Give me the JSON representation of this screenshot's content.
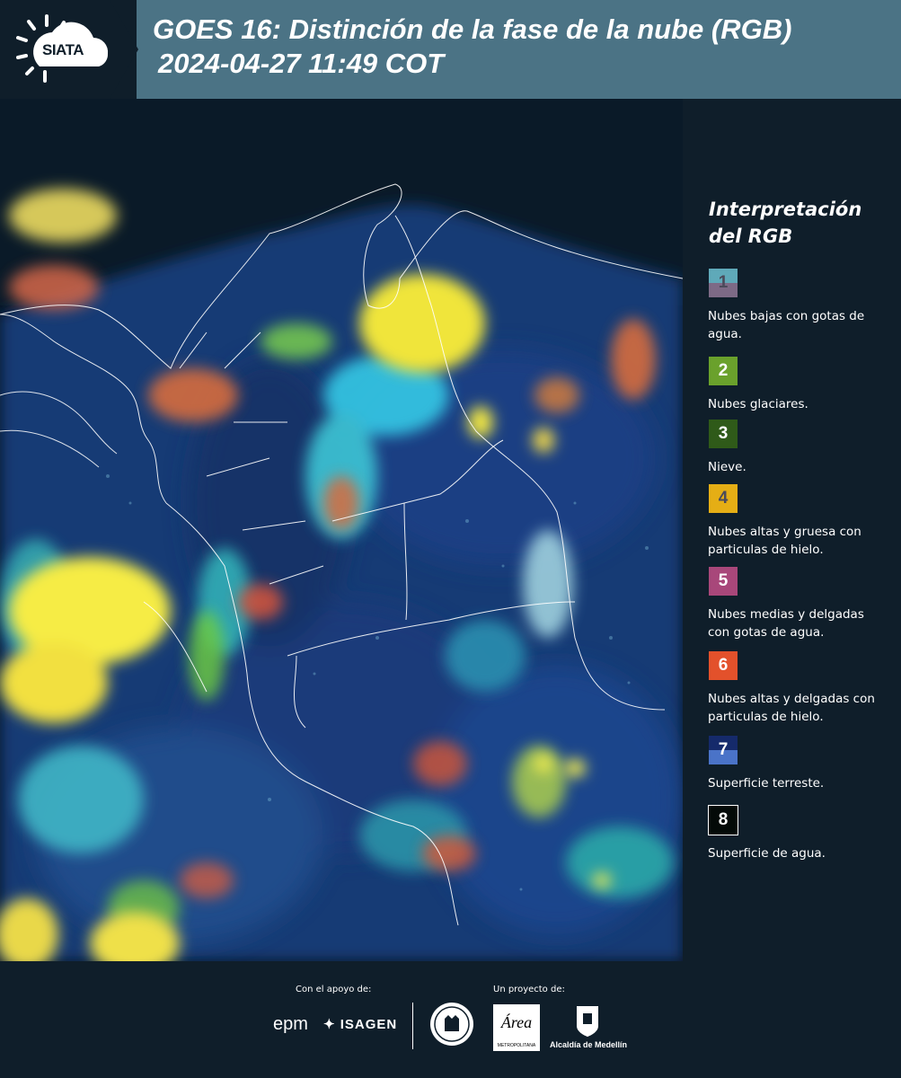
{
  "header": {
    "logo_text": "SIATA",
    "title_line1": "GOES 16: Distinción de la fase de la nube (RGB)",
    "title_line2": "2024-04-27 11:49 COT"
  },
  "legend": {
    "title_line1": "Interpretación",
    "title_line2": "del RGB",
    "items": [
      {
        "number": "1",
        "label": "Nubes bajas con gotas de agua.",
        "top_color": "#5fa9b9",
        "bottom_color": "#7d6a86",
        "text_color": "#4a4a5a"
      },
      {
        "number": "2",
        "label": "Nubes glaciares.",
        "top_color": "#6aa12c",
        "bottom_color": "#6aa12c",
        "text_color": "#ffffff"
      },
      {
        "number": "3",
        "label": "Nieve.",
        "top_color": "#2f5a19",
        "bottom_color": "#2f5a19",
        "text_color": "#ffffff"
      },
      {
        "number": "4",
        "label": "Nubes altas y gruesa con particulas de hielo.",
        "top_color": "#e5ae15",
        "bottom_color": "#e5ae15",
        "text_color": "#4a4a5a"
      },
      {
        "number": "5",
        "label": "Nubes medias y delgadas con gotas de agua.",
        "top_color": "#a8477a",
        "bottom_color": "#a8477a",
        "text_color": "#ffffff"
      },
      {
        "number": "6",
        "label": "Nubes altas y delgadas con particulas de hielo.",
        "top_color": "#e3512b",
        "bottom_color": "#e3512b",
        "text_color": "#ffffff"
      },
      {
        "number": "7",
        "label": "Superficie terreste.",
        "top_color": "#152a6b",
        "bottom_color": "#4a73c8",
        "text_color": "#ffffff"
      },
      {
        "number": "8",
        "label": "Superficie de agua.",
        "top_color": "#040a08",
        "bottom_color": "#040a08",
        "text_color": "#ffffff"
      }
    ]
  },
  "footer": {
    "support_label": "Con el apoyo de:",
    "project_label": "Un proyecto de:",
    "epm": "epm",
    "isagen": "ISAGEN",
    "amva_text": "METROPOLITANA",
    "medellin": "Alcaldía de Medellín"
  }
}
